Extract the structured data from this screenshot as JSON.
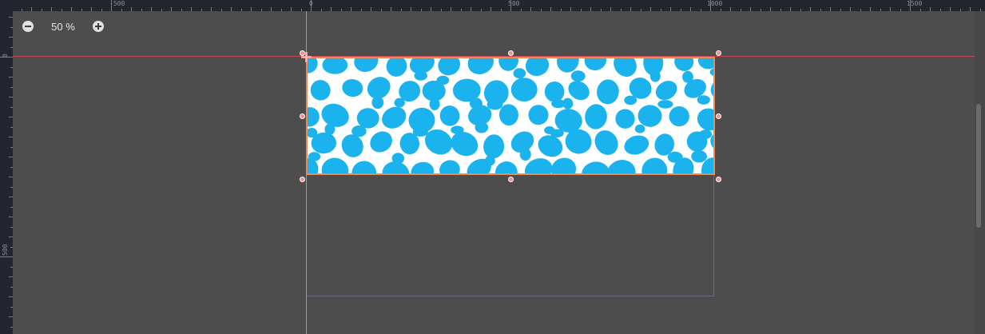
{
  "zoom": {
    "level": "50 %",
    "zoom_out_icon": "minus-circle-icon",
    "zoom_in_icon": "plus-circle-icon"
  },
  "rulers": {
    "top_labels": [
      "-500",
      "0",
      "500",
      "1000",
      "1500"
    ],
    "left_labels": [
      "0",
      "500"
    ]
  },
  "canvas": {
    "background_color": "#4d4d4d",
    "x_axis_color": "#c8484f",
    "y_axis_color": "#8fb63a",
    "selection_border_color": "#ee8a55",
    "handle_color": "#f28f8f",
    "viewport_outline_color": "#6a6a8e",
    "texture": {
      "water_color": "#1ab3ee",
      "foam_color": "#ffffff"
    }
  },
  "icons": {
    "pivot": "pivot-cross-icon"
  }
}
